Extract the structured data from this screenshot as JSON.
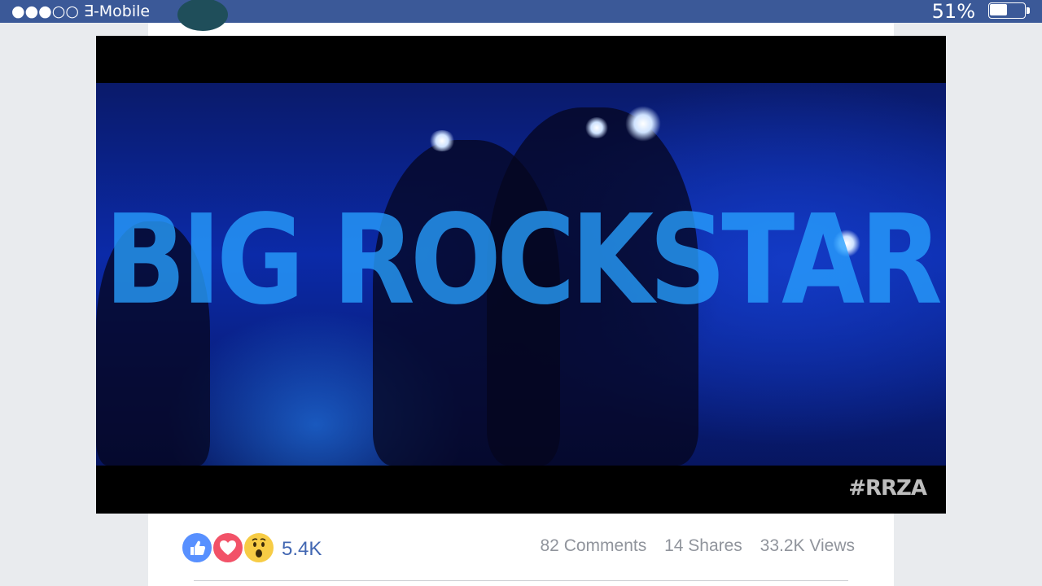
{
  "status_bar": {
    "carrier": "●●●○○ ∃-Mobile",
    "battery_percent": "51%",
    "battery_level": 0.51,
    "background_color": "#3b5998"
  },
  "video": {
    "title_text": "BIG ROCKSTAR",
    "tag": "#RRZA"
  },
  "post": {
    "reaction_icons": [
      "like-icon",
      "love-icon",
      "wow-icon"
    ],
    "reaction_count": "5.4K",
    "comments": "82 Comments",
    "shares": "14 Shares",
    "views": "33.2K Views",
    "link_color": "#4267b2"
  }
}
